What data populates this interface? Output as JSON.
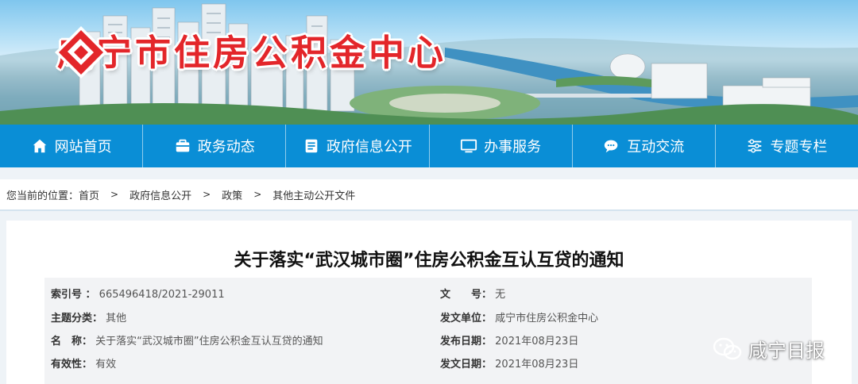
{
  "header": {
    "site_title": "咸宁市住房公积金中心"
  },
  "nav": [
    {
      "label": "网站首页",
      "icon": "home-icon"
    },
    {
      "label": "政务动态",
      "icon": "briefcase-icon"
    },
    {
      "label": "政府信息公开",
      "icon": "document-icon"
    },
    {
      "label": "办事服务",
      "icon": "monitor-icon"
    },
    {
      "label": "互动交流",
      "icon": "chat-icon"
    },
    {
      "label": "专题专栏",
      "icon": "sliders-icon"
    }
  ],
  "breadcrumb": {
    "lead": "您当前的位置：",
    "items": [
      "首页",
      "政府信息公开",
      "政策",
      "其他主动公开文件"
    ],
    "separator": ">"
  },
  "article": {
    "title": "关于落实“武汉城市圈”住房公积金互认互贷的通知",
    "meta": {
      "index_label": "索引号 ：",
      "index_value": "665496418/2021-29011",
      "doc_no_label": "文　　号：",
      "doc_no_value": "无",
      "category_label": "主题分类：",
      "category_value": "其他",
      "issuer_label": "发文单位：",
      "issuer_value": "咸宁市住房公积金中心",
      "name_label": "名　称：",
      "name_value": "关于落实“武汉城市圈”住房公积金互认互贷的通知",
      "publish_label": "发布日期：",
      "publish_value": "2021年08月23日",
      "validity_label": "有效性：",
      "validity_value": "有效",
      "issue_date_label": "发文日期：",
      "issue_date_value": "2021年08月23日"
    }
  },
  "watermark": {
    "text": "咸宁日报",
    "icon": "wechat-icon"
  },
  "colors": {
    "nav_bg": "#0a8ed6",
    "title_red": "#e3262a",
    "page_bg": "#eef3f7",
    "meta_bg": "#f2f3f5"
  }
}
